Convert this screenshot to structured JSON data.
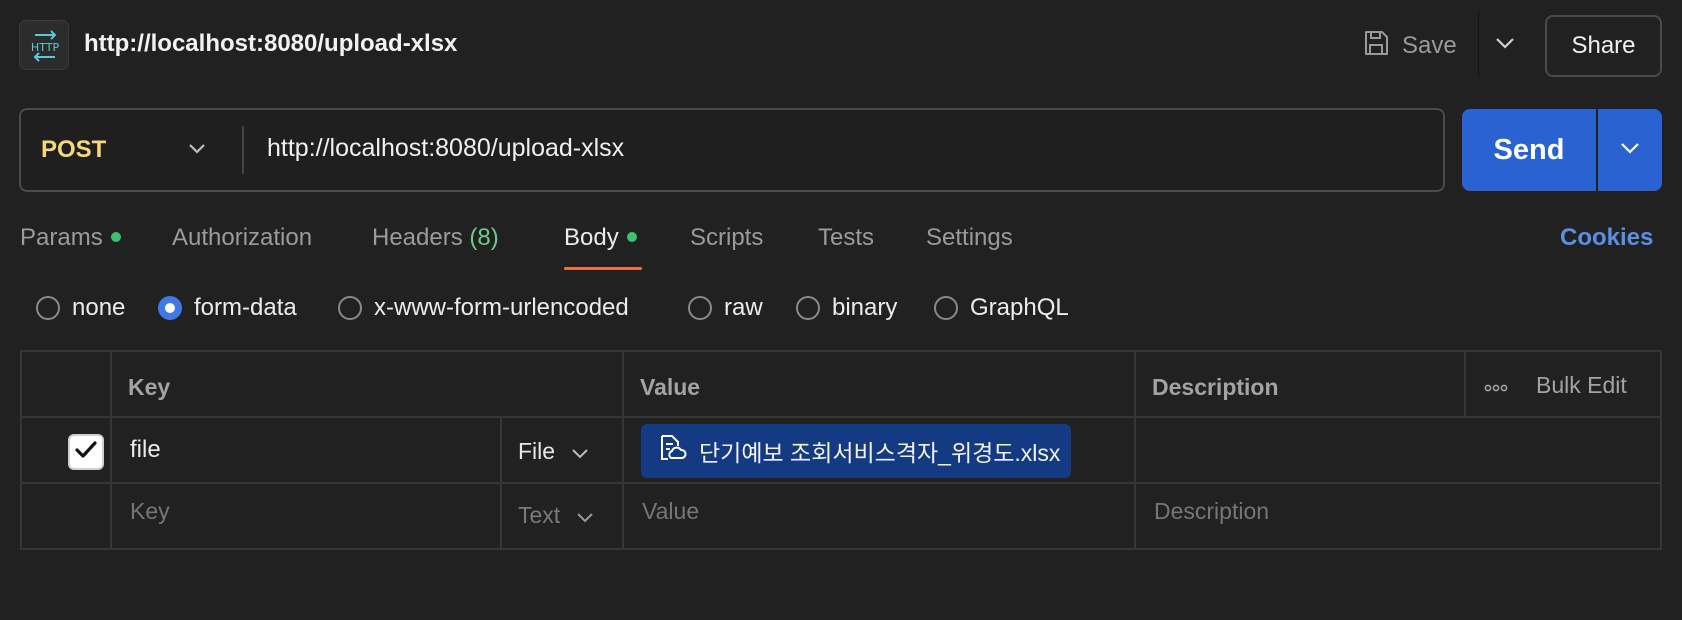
{
  "header": {
    "icon": "http-request-icon",
    "icon_text": "HTTP",
    "title": "http://localhost:8080/upload-xlsx",
    "save_label": "Save",
    "share_label": "Share"
  },
  "request": {
    "method": "POST",
    "url": "http://localhost:8080/upload-xlsx",
    "send_label": "Send"
  },
  "tabs": [
    {
      "label": "Params",
      "dot": true
    },
    {
      "label": "Authorization"
    },
    {
      "label": "Headers",
      "count": "(8)"
    },
    {
      "label": "Body",
      "dot": true,
      "active": true
    },
    {
      "label": "Scripts"
    },
    {
      "label": "Tests"
    },
    {
      "label": "Settings"
    }
  ],
  "cookies_label": "Cookies",
  "body_types": [
    {
      "label": "none"
    },
    {
      "label": "form-data",
      "selected": true
    },
    {
      "label": "x-www-form-urlencoded"
    },
    {
      "label": "raw"
    },
    {
      "label": "binary"
    },
    {
      "label": "GraphQL"
    }
  ],
  "table": {
    "headers": {
      "key": "Key",
      "value": "Value",
      "description": "Description",
      "bulk_edit": "Bulk Edit"
    },
    "rows": [
      {
        "checked": true,
        "key": "file",
        "type": "File",
        "value": "단기예보 조회서비스격자_위경도.xlsx",
        "description": ""
      }
    ],
    "new_row": {
      "key_placeholder": "Key",
      "type": "Text",
      "value_placeholder": "Value",
      "description_placeholder": "Description"
    }
  },
  "colors": {
    "accent": "#2a63d1",
    "method": "#f5d77a",
    "active_tab": "#ef6e45",
    "dot": "#3cc26f",
    "file_chip": "#143a84",
    "link": "#5b8fe6"
  }
}
